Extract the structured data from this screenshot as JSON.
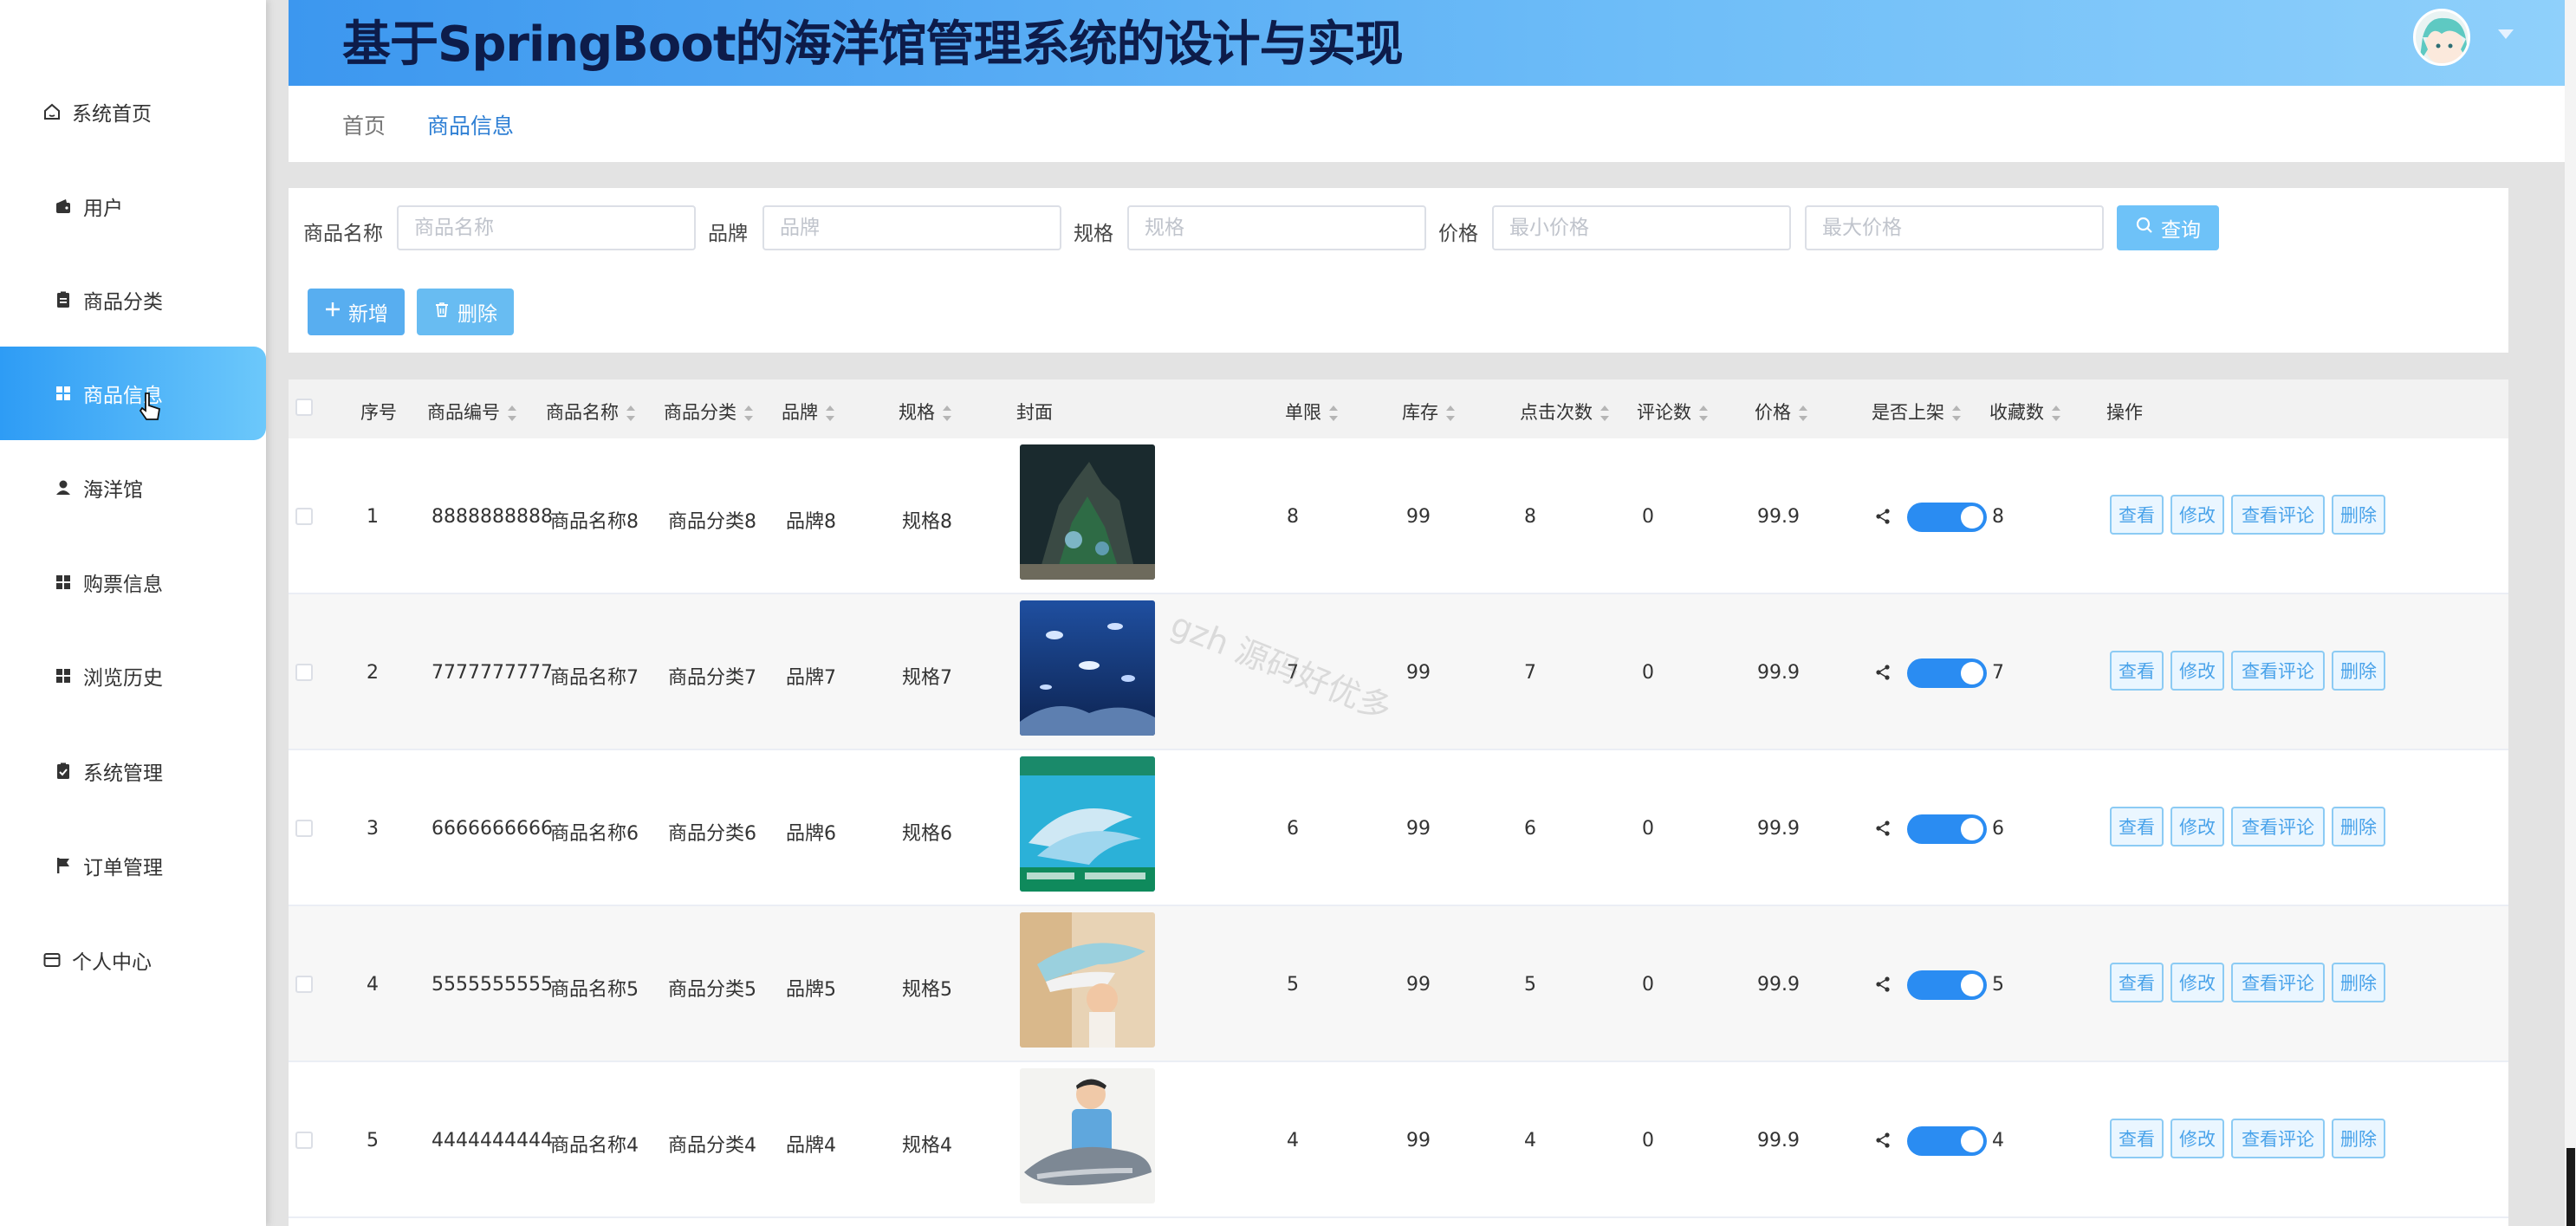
{
  "header": {
    "title": "基于SpringBoot的海洋馆管理系统的设计与实现"
  },
  "sidebar": {
    "items": [
      {
        "label": "系统首页",
        "icon": "home-icon"
      },
      {
        "label": "用户",
        "icon": "wallet-icon"
      },
      {
        "label": "商品分类",
        "icon": "clipboard-icon"
      },
      {
        "label": "商品信息",
        "icon": "grid-icon"
      },
      {
        "label": "海洋馆",
        "icon": "user-icon"
      },
      {
        "label": "购票信息",
        "icon": "grid-icon"
      },
      {
        "label": "浏览历史",
        "icon": "grid-icon"
      },
      {
        "label": "系统管理",
        "icon": "clipboard-check-icon"
      },
      {
        "label": "订单管理",
        "icon": "flag-icon"
      },
      {
        "label": "个人中心",
        "icon": "card-icon"
      }
    ]
  },
  "tabs": {
    "home": "首页",
    "current": "商品信息"
  },
  "search": {
    "name_label": "商品名称",
    "name_placeholder": "商品名称",
    "brand_label": "品牌",
    "brand_placeholder": "品牌",
    "spec_label": "规格",
    "spec_placeholder": "规格",
    "price_label": "价格",
    "min_price_placeholder": "最小价格",
    "max_price_placeholder": "最大价格",
    "query_label": "查询",
    "add_label": "新增",
    "delete_label": "删除"
  },
  "table": {
    "columns": {
      "index": "序号",
      "code": "商品编号",
      "name": "商品名称",
      "category": "商品分类",
      "brand": "品牌",
      "spec": "规格",
      "cover": "封面",
      "limit": "单限",
      "stock": "库存",
      "clicks": "点击次数",
      "comments": "评论数",
      "price": "价格",
      "onsale": "是否上架",
      "favorites": "收藏数",
      "actions": "操作"
    },
    "rows": [
      {
        "index": "1",
        "code": "8888888888",
        "name": "商品名称8",
        "category": "商品分类8",
        "brand": "品牌8",
        "spec": "规格8",
        "limit": "8",
        "stock": "99",
        "clicks": "8",
        "comments": "0",
        "price": "99.9",
        "favorites": "8"
      },
      {
        "index": "2",
        "code": "7777777777",
        "name": "商品名称7",
        "category": "商品分类7",
        "brand": "品牌7",
        "spec": "规格7",
        "limit": "7",
        "stock": "99",
        "clicks": "7",
        "comments": "0",
        "price": "99.9",
        "favorites": "7"
      },
      {
        "index": "3",
        "code": "6666666666",
        "name": "商品名称6",
        "category": "商品分类6",
        "brand": "品牌6",
        "spec": "规格6",
        "limit": "6",
        "stock": "99",
        "clicks": "6",
        "comments": "0",
        "price": "99.9",
        "favorites": "6"
      },
      {
        "index": "4",
        "code": "5555555555",
        "name": "商品名称5",
        "category": "商品分类5",
        "brand": "品牌5",
        "spec": "规格5",
        "limit": "5",
        "stock": "99",
        "clicks": "5",
        "comments": "0",
        "price": "99.9",
        "favorites": "5"
      },
      {
        "index": "5",
        "code": "4444444444",
        "name": "商品名称4",
        "category": "商品分类4",
        "brand": "品牌4",
        "spec": "规格4",
        "limit": "4",
        "stock": "99",
        "clicks": "4",
        "comments": "0",
        "price": "99.9",
        "favorites": "4"
      }
    ],
    "actions": {
      "view": "查看",
      "edit": "修改",
      "view_comments": "查看评论",
      "delete": "删除"
    }
  },
  "watermark": "gzh 源码好优多",
  "colors": {
    "accent": "#2a8cf2",
    "header_start": "#3c97ef",
    "header_end": "#8fd0fb",
    "button_light": "#6ec2f8"
  }
}
